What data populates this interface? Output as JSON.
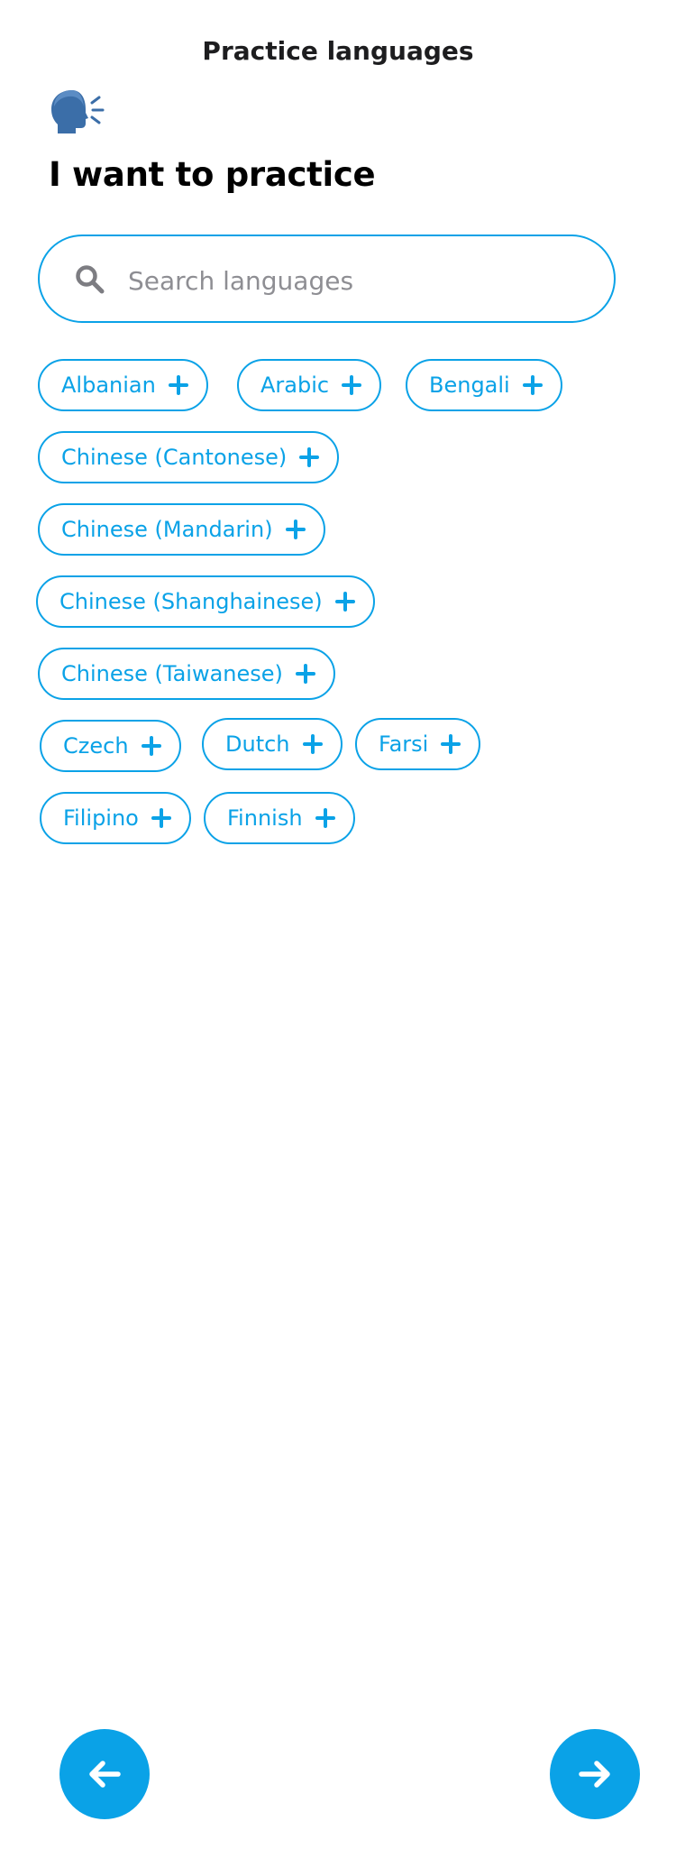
{
  "header": {
    "title": "Practice languages"
  },
  "hero": {
    "icon": "speaking-head-icon",
    "heading": "I want to practice"
  },
  "search": {
    "placeholder": "Search languages",
    "value": "",
    "icon": "search-icon"
  },
  "languages": [
    "Albanian",
    "Arabic",
    "Bengali",
    "Chinese (Cantonese)",
    "Chinese (Mandarin)",
    "Chinese (Shanghainese)",
    "Chinese (Taiwanese)",
    "Czech",
    "Dutch",
    "Farsi",
    "Filipino",
    "Finnish"
  ],
  "chip_action_icon": "plus-icon",
  "nav": {
    "back_icon": "arrow-left-icon",
    "next_icon": "arrow-right-icon"
  },
  "colors": {
    "accent": "#0aa2e7",
    "placeholder": "#8e8e93",
    "text": "#000000"
  }
}
